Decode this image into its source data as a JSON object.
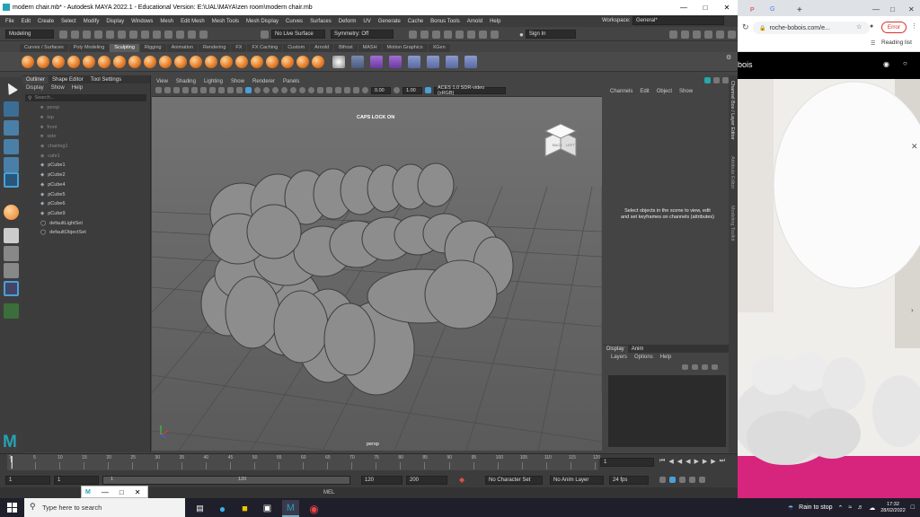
{
  "maya": {
    "title": "modern chair.mb* - Autodesk MAYA 2022.1 - Educational Version: E:\\UAL\\MAYA\\zen room\\modern chair.mb",
    "menus": [
      "File",
      "Edit",
      "Create",
      "Select",
      "Modify",
      "Display",
      "Windows",
      "Mesh",
      "Edit Mesh",
      "Mesh Tools",
      "Mesh Display",
      "Curves",
      "Surfaces",
      "Deform",
      "UV",
      "Generate",
      "Cache",
      "Bonus Tools",
      "Arnold",
      "Help"
    ],
    "workspace_label": "Workspace:",
    "workspace_value": "General*",
    "mode": "Modeling",
    "live_surface": "No Live Surface",
    "symmetry": "Symmetry: Off",
    "sign_in": "Sign In",
    "shelf_tabs": [
      "Curves / Surfaces",
      "Poly Modeling",
      "Sculpting",
      "Rigging",
      "Animation",
      "Rendering",
      "FX",
      "FX Caching",
      "Custom",
      "Arnold",
      "Bifrost",
      "MASH",
      "Motion Graphics",
      "XGen"
    ],
    "shelf_active": "Sculpting"
  },
  "outliner": {
    "tabs": [
      "Outliner",
      "Shape Editor",
      "Tool Settings"
    ],
    "menu": [
      "Display",
      "Show",
      "Help"
    ],
    "search_placeholder": "Search...",
    "items": [
      {
        "name": "persp",
        "dim": true
      },
      {
        "name": "top",
        "dim": true
      },
      {
        "name": "front",
        "dim": true
      },
      {
        "name": "side",
        "dim": true
      },
      {
        "name": "chairleg1",
        "dim": true
      },
      {
        "name": "cafe1",
        "dim": true
      },
      {
        "name": "pCube1",
        "dim": false
      },
      {
        "name": "pCube2",
        "dim": false
      },
      {
        "name": "pCube4",
        "dim": false
      },
      {
        "name": "pCube5",
        "dim": false
      },
      {
        "name": "pCube6",
        "dim": false
      },
      {
        "name": "pCube9",
        "dim": false
      },
      {
        "name": "defaultLightSet",
        "dim": false
      },
      {
        "name": "defaultObjectSet",
        "dim": false
      }
    ]
  },
  "viewport": {
    "menus": [
      "View",
      "Shading",
      "Lighting",
      "Show",
      "Renderer",
      "Panels"
    ],
    "exposure": "0.00",
    "gamma": "1.00",
    "colorspace": "ACES 1.0 SDR-video (sRGB)",
    "caps_lock": "CAPS LOCK ON",
    "camera": "persp",
    "cube_back": "BACK",
    "cube_left": "LEFT"
  },
  "channel_box": {
    "menus": [
      "Channels",
      "Edit",
      "Object",
      "Show"
    ],
    "hint": "Select objects in the scene to view, edit and set keyframes on channels (attributes)",
    "side_tabs": [
      "Channel Box / Layer Editor",
      "Attribute Editor",
      "Modeling Toolkit"
    ]
  },
  "layers": {
    "tabs": [
      "Display",
      "Anim"
    ],
    "menus": [
      "Layers",
      "Options",
      "Help"
    ]
  },
  "timeline": {
    "ticks": [
      "1",
      "5",
      "10",
      "15",
      "20",
      "25",
      "30",
      "35",
      "40",
      "45",
      "50",
      "55",
      "60",
      "65",
      "70",
      "75",
      "80",
      "85",
      "90",
      "95",
      "100",
      "105",
      "110",
      "115",
      "120"
    ],
    "current": "1",
    "range_start": "1",
    "range_inner_start": "1",
    "range_inner_end": "120",
    "range_end_a": "120",
    "range_end_b": "200",
    "char_set": "No Character Set",
    "anim_layer": "No Anim Layer",
    "fps": "24 fps",
    "mel": "MEL"
  },
  "browser": {
    "tab_label": "G",
    "address": "roche-bobois.com/e...",
    "error_label": "Error",
    "reading_list": "Reading list",
    "site_logo": "bois"
  },
  "taskbar": {
    "search_placeholder": "Type here to search",
    "weather": "Rain to stop",
    "time": "17:32",
    "date": "28/02/2022"
  },
  "popup_title": "M"
}
